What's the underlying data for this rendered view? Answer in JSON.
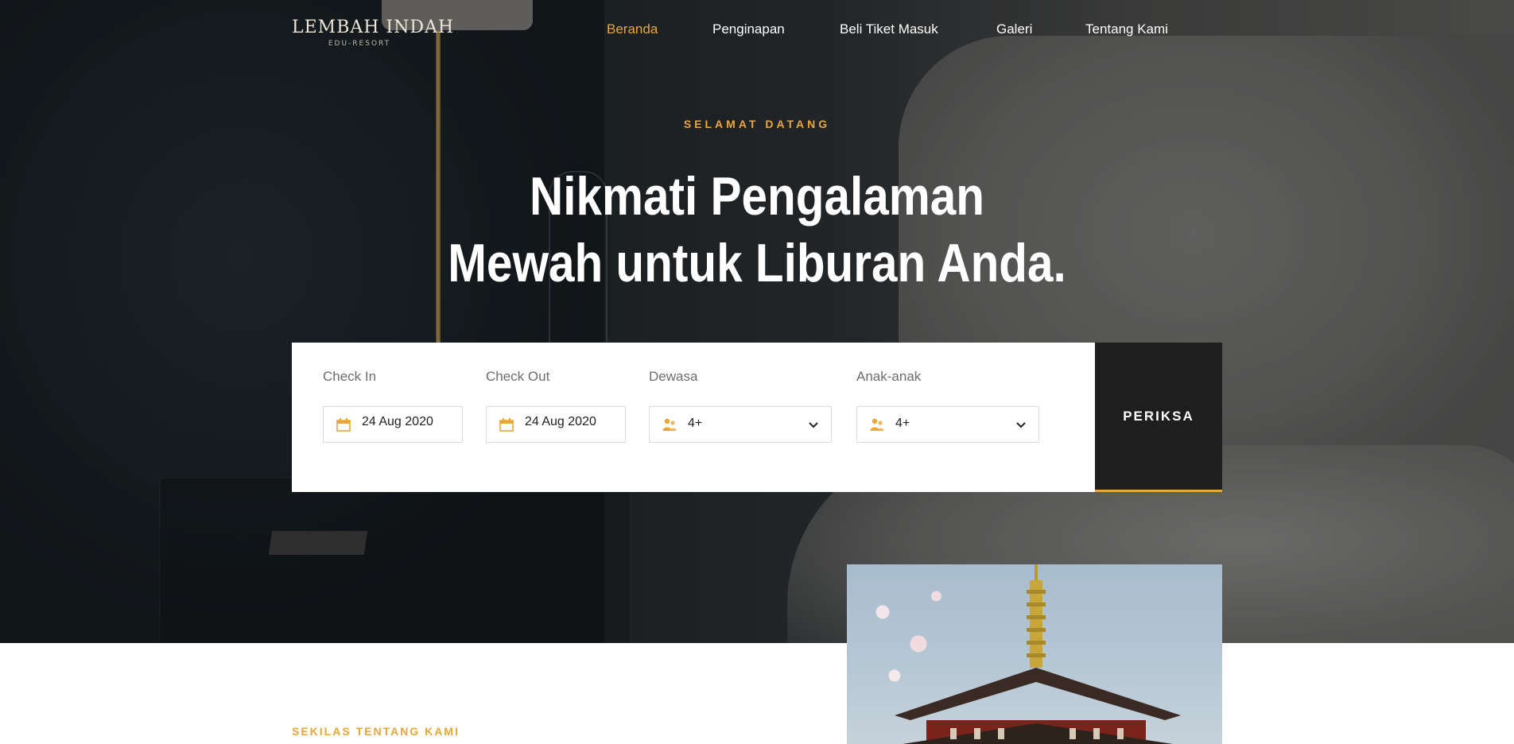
{
  "header": {
    "logo_text": "LEMBAH INDAH",
    "logo_tagline": "EDU-RESORT",
    "nav": [
      {
        "label": "Beranda",
        "active": true
      },
      {
        "label": "Penginapan",
        "active": false
      },
      {
        "label": "Beli Tiket Masuk",
        "active": false
      },
      {
        "label": "Galeri",
        "active": false
      },
      {
        "label": "Tentang Kami",
        "active": false
      }
    ]
  },
  "hero": {
    "eyebrow": "SELAMAT DATANG",
    "headline_line1": "Nikmati Pengalaman",
    "headline_line2": "Mewah untuk Liburan Anda."
  },
  "booking": {
    "check_in": {
      "label": "Check In",
      "value": "24 Aug 2020",
      "icon": "calendar-icon"
    },
    "check_out": {
      "label": "Check Out",
      "value": "24 Aug 2020",
      "icon": "calendar-icon"
    },
    "adults": {
      "label": "Dewasa",
      "value": "4+",
      "icon": "people-icon"
    },
    "children": {
      "label": "Anak-anak",
      "value": "4+",
      "icon": "people-icon"
    },
    "submit_label": "PERIKSA"
  },
  "about": {
    "eyebrow": "SEKILAS TENTANG KAMI"
  },
  "colors": {
    "accent": "#e9a63a",
    "dark": "#1e1e1e"
  }
}
